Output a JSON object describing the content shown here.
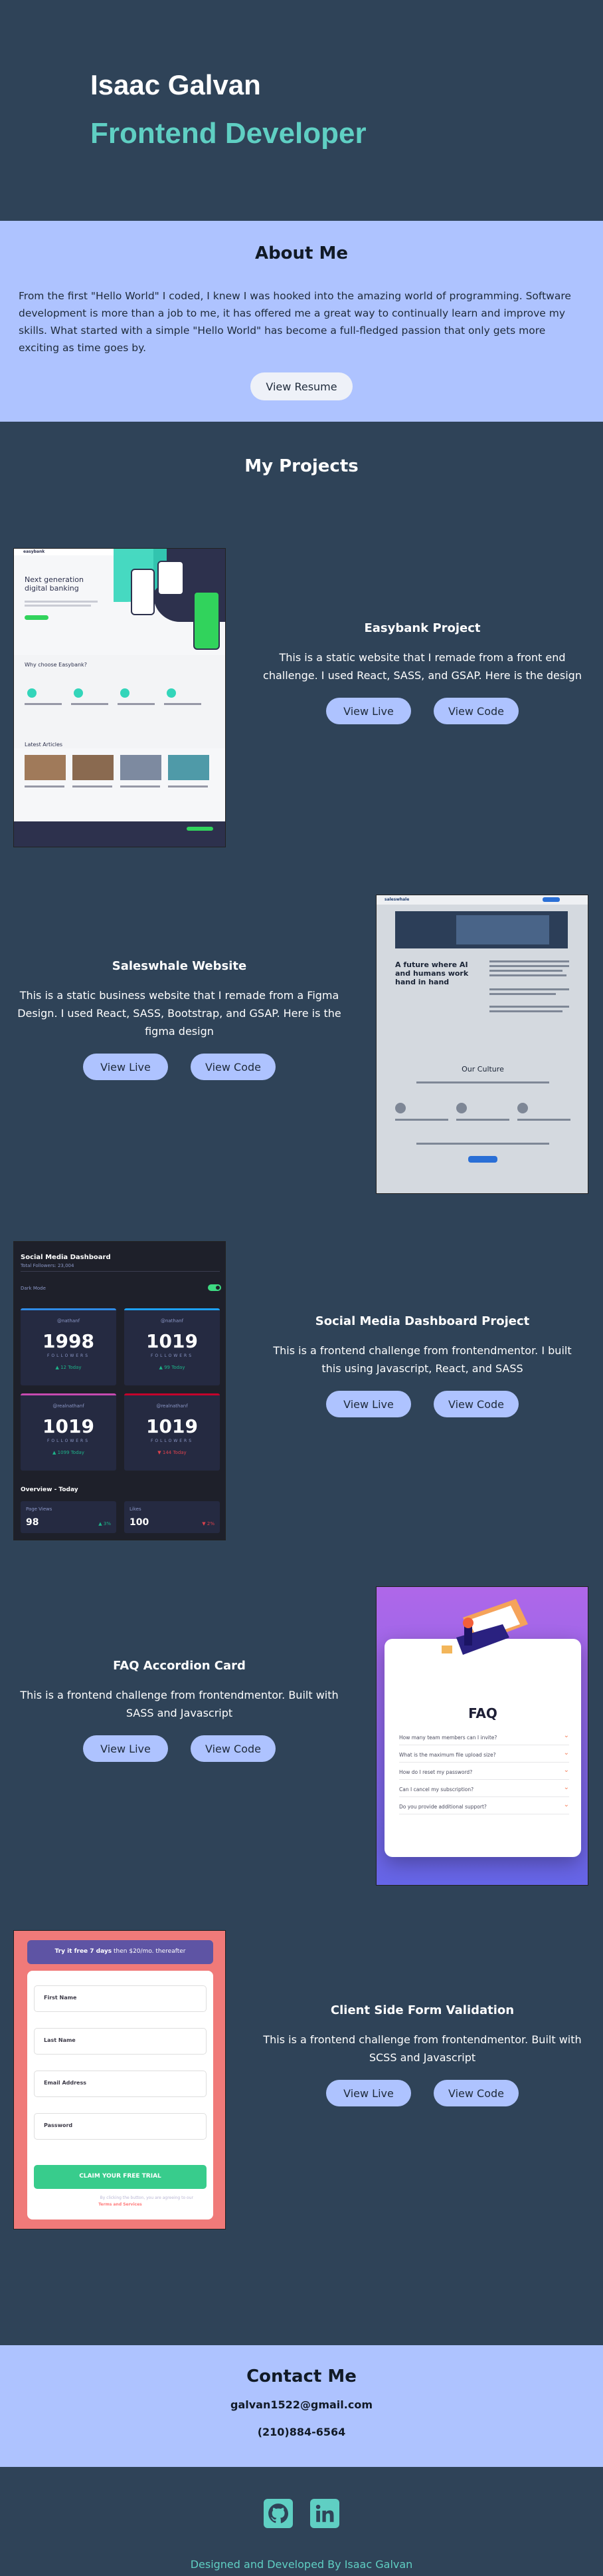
{
  "hero": {
    "name": "Isaac Galvan",
    "role": "Frontend Developer"
  },
  "about": {
    "title": "About Me",
    "text": "From the first \"Hello World\" I coded, I knew I was hooked into the amazing world of programming. Software development is more than a job to me, it has offered me a great way to continually learn and improve my skills. What started with a simple \"Hello World\" has become a full-fledged passion that only gets more exciting as time goes by.",
    "resume_label": "View Resume"
  },
  "projects": {
    "title": "My Projects",
    "live_label": "View Live",
    "code_label": "View Code",
    "items": [
      {
        "name": "Easybank Project",
        "desc": "This is a static website that I remade from a front end challenge. I used React, SASS, and GSAP. Here is the design",
        "shot": {
          "logo": "easybank",
          "headline": "Next generation digital banking",
          "section": "Why choose Easybank?",
          "articles": "Latest Articles"
        }
      },
      {
        "name": "Saleswhale Website",
        "desc": "This is a static business website that I remade from a Figma Design. I used React, SASS, Bootstrap, and GSAP. Here is the figma design",
        "shot": {
          "logo": "saleswhale",
          "headline": "A future where AI and humans work hand in hand",
          "section": "Our Culture"
        }
      },
      {
        "name": "Social Media Dashboard Project",
        "desc": "This is a frontend challenge from frontendmentor. I built this using Javascript, React, and SASS",
        "shot": {
          "title": "Social Media Dashboard",
          "subtitle": "Total Followers: 23,004",
          "dark_mode": "Dark Mode",
          "followers_label": "FOLLOWERS",
          "cards": [
            {
              "handle": "@nathanf",
              "count": "1998",
              "today": "▲ 12 Today",
              "color": "#2f8be6"
            },
            {
              "handle": "@nathanf",
              "count": "1019",
              "today": "▲ 99 Today",
              "color": "#1da0f2"
            },
            {
              "handle": "@realnathanf",
              "count": "1019",
              "today": "▲ 1099 Today",
              "color": "#c74ab0"
            },
            {
              "handle": "@realnathanf",
              "count": "1019",
              "today": "▼ 144 Today",
              "color": "#c4032b"
            }
          ],
          "overview": "Overview - Today",
          "mini": [
            {
              "label": "Page Views",
              "value": "98",
              "pct": "▲ 3%"
            },
            {
              "label": "Likes",
              "value": "100",
              "pct": "▼ 2%"
            }
          ]
        }
      },
      {
        "name": "FAQ Accordion Card",
        "desc": "This is a frontend challenge from frontendmentor. Built with SASS and Javascript",
        "shot": {
          "title": "FAQ",
          "questions": [
            "How many team members can I invite?",
            "What is the maximum file upload size?",
            "How do I reset my password?",
            "Can I cancel my subscription?",
            "Do you provide additional support?"
          ]
        }
      },
      {
        "name": "Client Side Form Validation",
        "desc": "This is a frontend challenge from frontendmentor. Built with SCSS and Javascript",
        "shot": {
          "banner_bold": "Try it free 7 days",
          "banner_rest": " then $20/mo. thereafter",
          "fields": [
            "First Name",
            "Last Name",
            "Email Address",
            "Password"
          ],
          "submit": "CLAIM YOUR FREE TRIAL",
          "terms": "By clicking the button, you are agreeing to our",
          "terms_link": "Terms and Services"
        }
      }
    ]
  },
  "contact": {
    "title": "Contact Me",
    "email": "galvan1522@gmail.com",
    "phone": "(210)884-6564"
  },
  "footer": {
    "text": "Designed and Developed By Isaac Galvan"
  },
  "colors": {
    "background": "#2f4358",
    "accent": "#5fcfc3",
    "light": "#aec3ff"
  }
}
